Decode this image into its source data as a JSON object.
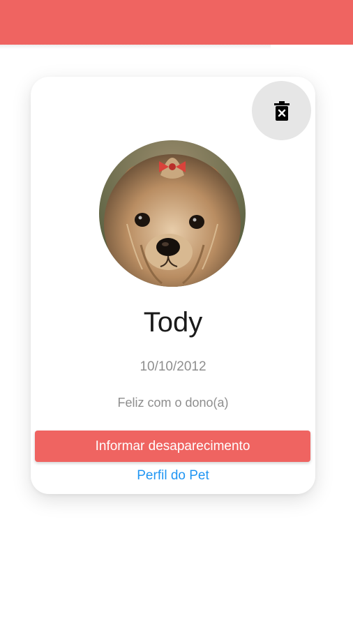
{
  "app_bar": {
    "color": "#ef6461"
  },
  "pet_card": {
    "name": "Tody",
    "birth_date": "10/10/2012",
    "status": "Feliz com o dono(a)",
    "report_missing_label": "Informar desaparecimento",
    "profile_link_label": "Perfil do Pet",
    "delete_icon": "trash-x-icon",
    "photo": "yorkshire-terrier-photo"
  },
  "colors": {
    "accent": "#ef6461",
    "link": "#2196f3",
    "muted_text": "#8e8e8e"
  }
}
